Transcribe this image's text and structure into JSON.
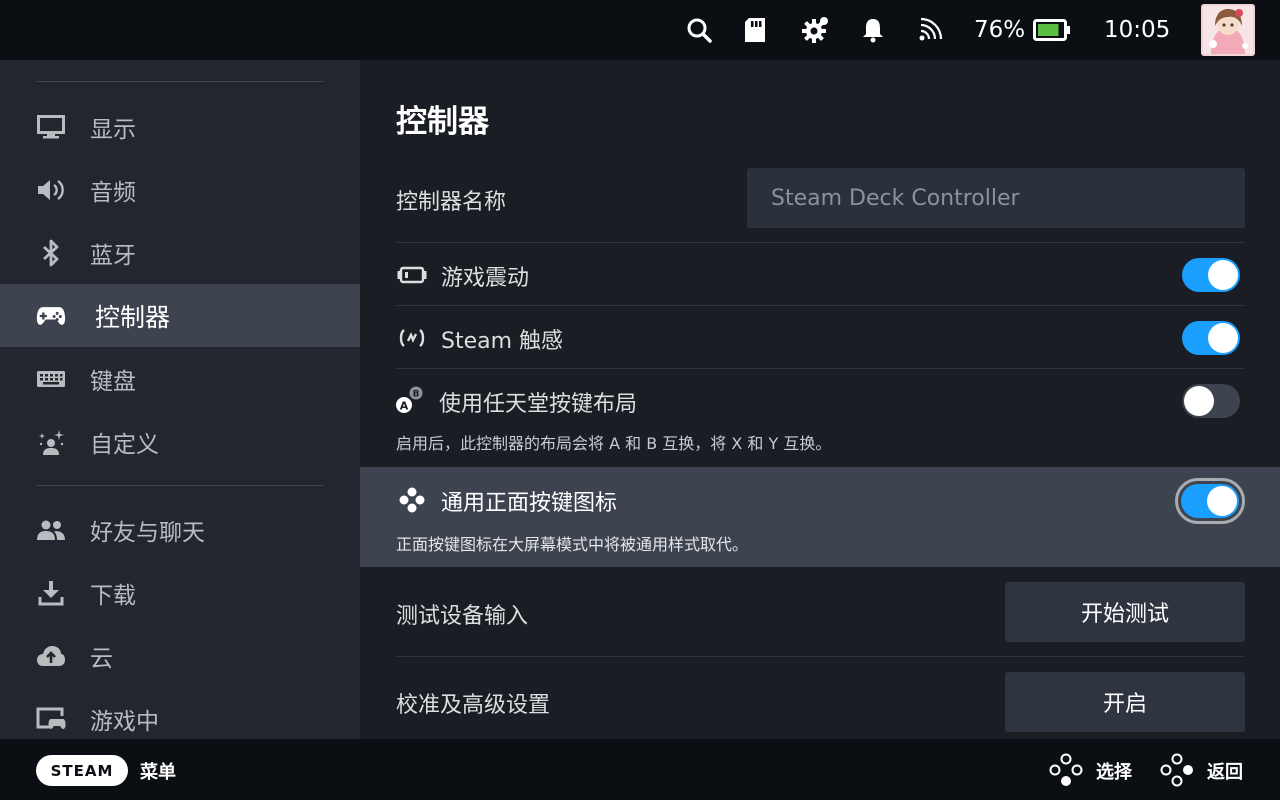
{
  "status_bar": {
    "battery_percent": "76%",
    "battery_level": 0.76,
    "time": "10:05",
    "icons": [
      "search-icon",
      "sd-card-icon",
      "settings-gear-icon",
      "notification-bell-icon",
      "wifi-icon",
      "battery-icon",
      "user-avatar"
    ]
  },
  "sidebar": {
    "items": [
      {
        "label": "显示",
        "icon": "monitor-icon"
      },
      {
        "label": "音频",
        "icon": "speaker-icon"
      },
      {
        "label": "蓝牙",
        "icon": "bluetooth-icon"
      },
      {
        "label": "控制器",
        "icon": "gamepad-icon",
        "active": true
      },
      {
        "label": "键盘",
        "icon": "keyboard-icon"
      },
      {
        "label": "自定义",
        "icon": "sparkle-person-icon"
      },
      {
        "label": "好友与聊天",
        "icon": "friends-icon"
      },
      {
        "label": "下载",
        "icon": "download-icon"
      },
      {
        "label": "云",
        "icon": "cloud-icon"
      },
      {
        "label": "游戏中",
        "icon": "in-game-icon"
      }
    ]
  },
  "main": {
    "title": "控制器",
    "controller_name": {
      "label": "控制器名称",
      "value": "Steam Deck Controller"
    },
    "game_rumble": {
      "label": "游戏震动",
      "enabled": true
    },
    "steam_haptics": {
      "label": "Steam 触感",
      "enabled": true
    },
    "nintendo_layout": {
      "label": "使用任天堂按键布局",
      "enabled": false,
      "description": "启用后，此控制器的布局会将 A 和 B 互换，将 X 和 Y 互换。"
    },
    "generic_glyphs": {
      "label": "通用正面按键图标",
      "enabled": true,
      "description": "正面按键图标在大屏幕模式中将被通用样式取代。"
    },
    "test_input": {
      "label": "测试设备输入",
      "button": "开始测试"
    },
    "calibration": {
      "label": "校准及高级设置",
      "button": "开启"
    }
  },
  "bottom_bar": {
    "steam_button": "STEAM",
    "menu_label": "菜单",
    "select_label": "选择",
    "back_label": "返回"
  },
  "colors": {
    "accent": "#1a9fff",
    "sidebar_bg": "#23262e",
    "main_bg": "#1a1d23",
    "active_bg": "#3d4450",
    "battery_fill": "#59bf40"
  }
}
